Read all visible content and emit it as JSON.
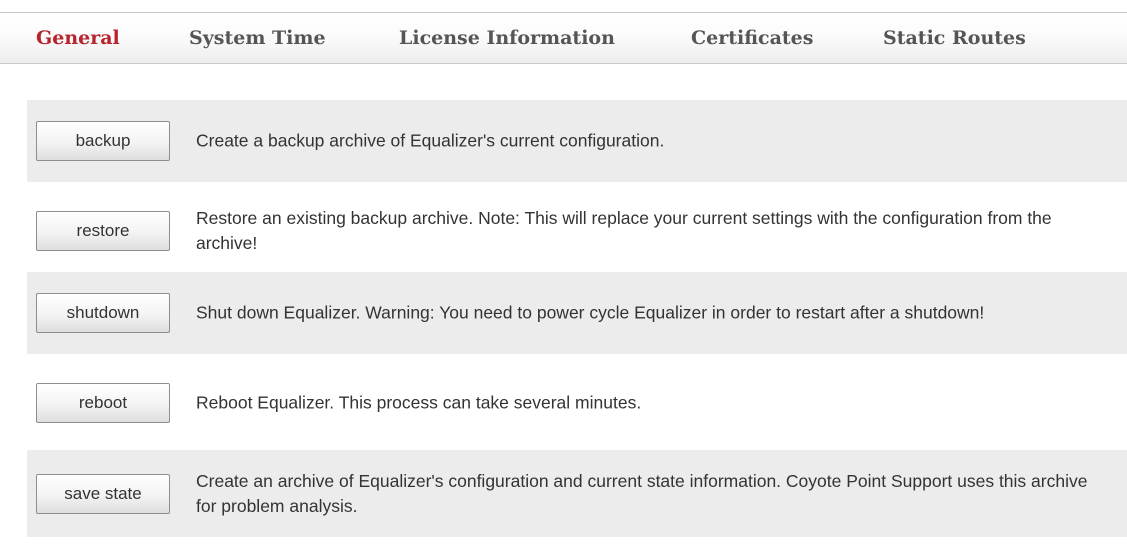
{
  "tabs": [
    {
      "label": "General",
      "active": true
    },
    {
      "label": "System Time",
      "active": false
    },
    {
      "label": "License Information",
      "active": false
    },
    {
      "label": "Certificates",
      "active": false
    },
    {
      "label": "Static Routes",
      "active": false
    }
  ],
  "actions": [
    {
      "button_label": "backup",
      "description": "Create a backup archive of Equalizer's current configuration."
    },
    {
      "button_label": "restore",
      "description": "Restore an existing backup archive. Note: This will replace your current settings with the configuration from the archive!"
    },
    {
      "button_label": "shutdown",
      "description": "Shut down Equalizer. Warning: You need to power cycle Equalizer in order to restart after a shutdown!"
    },
    {
      "button_label": "reboot",
      "description": "Reboot Equalizer. This process can take several minutes."
    },
    {
      "button_label": "save state",
      "description": "Create an archive of Equalizer's configuration and current state information. Coyote Point Support uses this archive for problem analysis."
    }
  ],
  "colors": {
    "active_tab": "#b8242e",
    "inactive_tab": "#555555",
    "row_shade": "#ececec"
  }
}
